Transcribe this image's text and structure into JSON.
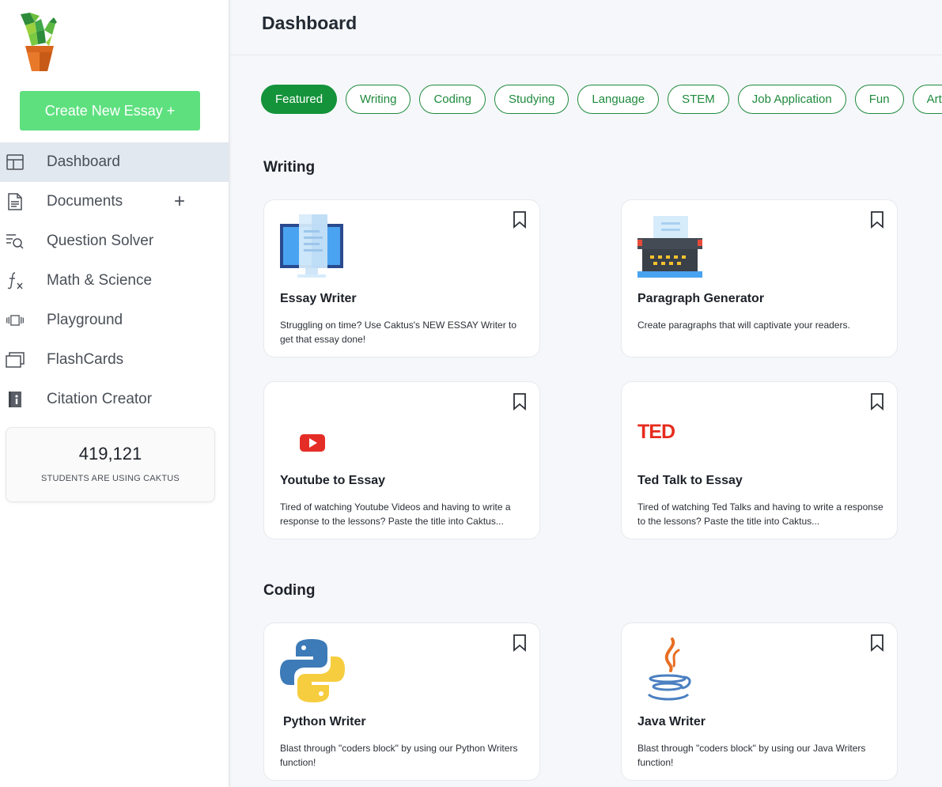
{
  "sidebar": {
    "create_button": "Create New Essay +",
    "nav": [
      {
        "label": "Dashboard",
        "icon": "layout-icon",
        "active": true
      },
      {
        "label": "Documents",
        "icon": "document-icon",
        "plus": "+"
      },
      {
        "label": "Question Solver",
        "icon": "search-list-icon"
      },
      {
        "label": "Math & Science",
        "icon": "function-icon"
      },
      {
        "label": "Playground",
        "icon": "carousel-icon"
      },
      {
        "label": "FlashCards",
        "icon": "cards-icon"
      },
      {
        "label": "Citation Creator",
        "icon": "citation-book-icon"
      }
    ],
    "stats": {
      "number": "419,121",
      "label": "STUDENTS ARE USING CAKTUS"
    }
  },
  "header": {
    "title": "Dashboard"
  },
  "chips": [
    "Featured",
    "Writing",
    "Coding",
    "Studying",
    "Language",
    "STEM",
    "Job Application",
    "Fun",
    "Arts"
  ],
  "sections": {
    "writing": {
      "title": "Writing",
      "cards": [
        {
          "title": "Essay Writer",
          "desc": "Struggling on time? Use Caktus's NEW ESSAY Writer to get that essay done!",
          "icon": "monitor-icon"
        },
        {
          "title": "Paragraph Generator",
          "desc": "Create paragraphs that will captivate your readers.",
          "icon": "typewriter-icon"
        },
        {
          "title": "Youtube to Essay",
          "desc": "Tired of watching Youtube Videos and having to write a response to the lessons? Paste the title into Caktus...",
          "icon": "youtube-icon"
        },
        {
          "title": "Ted Talk to Essay",
          "desc": "Tired of watching Ted Talks and having to write a response to the lessons? Paste the title into Caktus...",
          "icon": "ted-icon",
          "logo_text": "TED"
        }
      ]
    },
    "coding": {
      "title": "Coding",
      "cards": [
        {
          "title": "Python Writer",
          "desc": "Blast through \"coders block\" by using our Python Writers function!",
          "icon": "python-icon"
        },
        {
          "title": "Java Writer",
          "desc": "Blast through \"coders block\" by using our Java Writers function!",
          "icon": "java-icon"
        }
      ]
    }
  },
  "colors": {
    "accent": "#14933a",
    "create_button": "#5ee07f",
    "youtube_red": "#e52d27",
    "ted_red": "#e62b1e"
  }
}
